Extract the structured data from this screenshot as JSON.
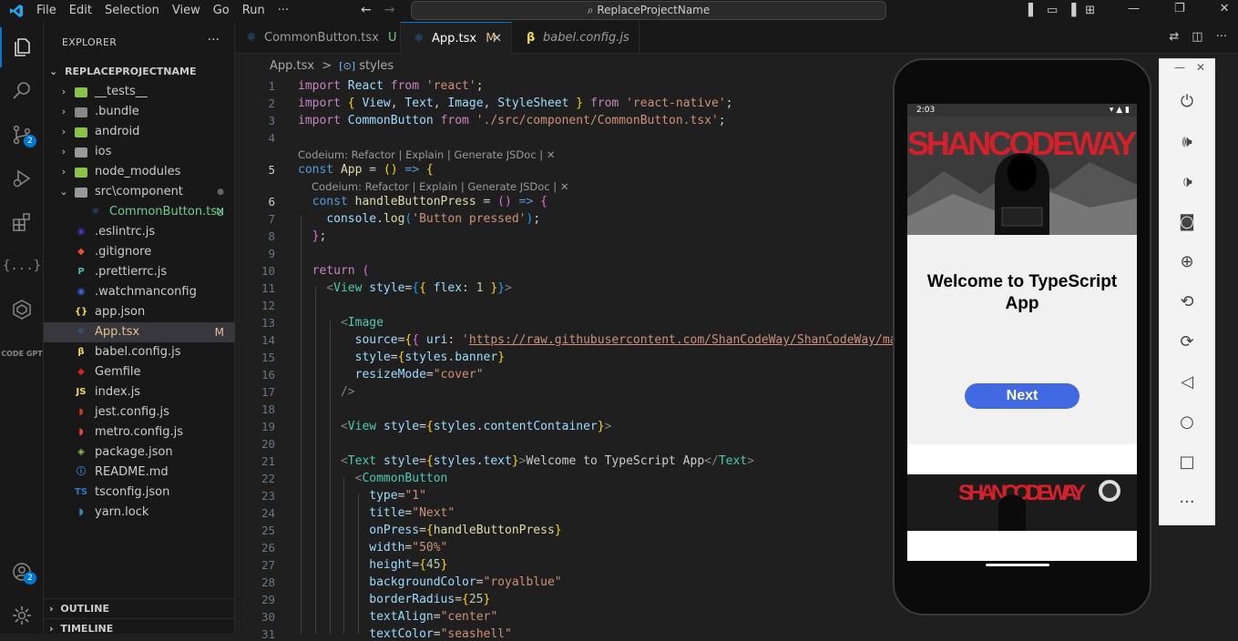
{
  "titlebar": {
    "menus": [
      "File",
      "Edit",
      "Selection",
      "View",
      "Go",
      "Run",
      "···"
    ],
    "search_text": "ReplaceProjectName"
  },
  "activity_bar": {
    "source_control_badge": "2",
    "accounts_badge": "2",
    "codegpt_label": "CODE GPT"
  },
  "explorer": {
    "header": "EXPLORER",
    "more": "···",
    "project_name": "REPLACEPROJECTNAME",
    "items": [
      {
        "name": "__tests__",
        "type": "folder",
        "status": ""
      },
      {
        "name": ".bundle",
        "type": "folder",
        "status": ""
      },
      {
        "name": "android",
        "type": "folder",
        "status": ""
      },
      {
        "name": "ios",
        "type": "folder",
        "status": ""
      },
      {
        "name": "node_modules",
        "type": "folder",
        "status": ""
      },
      {
        "name": "src\\component",
        "type": "folder-open",
        "status": "●"
      },
      {
        "name": "CommonButton.tsx",
        "type": "file",
        "status": "U"
      },
      {
        "name": ".eslintrc.js",
        "type": "file",
        "status": ""
      },
      {
        "name": ".gitignore",
        "type": "file",
        "status": ""
      },
      {
        "name": ".prettierrc.js",
        "type": "file",
        "status": ""
      },
      {
        "name": ".watchmanconfig",
        "type": "file",
        "status": ""
      },
      {
        "name": "app.json",
        "type": "file",
        "status": ""
      },
      {
        "name": "App.tsx",
        "type": "file",
        "status": "M"
      },
      {
        "name": "babel.config.js",
        "type": "file",
        "status": ""
      },
      {
        "name": "Gemfile",
        "type": "file",
        "status": ""
      },
      {
        "name": "index.js",
        "type": "file",
        "status": ""
      },
      {
        "name": "jest.config.js",
        "type": "file",
        "status": ""
      },
      {
        "name": "metro.config.js",
        "type": "file",
        "status": ""
      },
      {
        "name": "package.json",
        "type": "file",
        "status": ""
      },
      {
        "name": "README.md",
        "type": "file",
        "status": ""
      },
      {
        "name": "tsconfig.json",
        "type": "file",
        "status": ""
      },
      {
        "name": "yarn.lock",
        "type": "file",
        "status": ""
      }
    ],
    "outline": "OUTLINE",
    "timeline": "TIMELINE"
  },
  "tabs": [
    {
      "name": "CommonButton.tsx",
      "status": "U",
      "active": false
    },
    {
      "name": "App.tsx",
      "status": "M",
      "active": true
    },
    {
      "name": "babel.config.js",
      "status": "",
      "active": false
    }
  ],
  "breadcrumb": {
    "file": "App.tsx",
    "separator": ">",
    "symbol": "styles"
  },
  "codelens": "Codeium: Refactor | Explain | Generate JSDoc | ✕",
  "emulator": {
    "status_time": "2:03",
    "banner_text": "SHANCODEWAY",
    "welcome_text": "Welcome to TypeScript App",
    "button_label": "Next"
  },
  "colors": {
    "accent": "#0078d4",
    "button": "#4169e1"
  }
}
